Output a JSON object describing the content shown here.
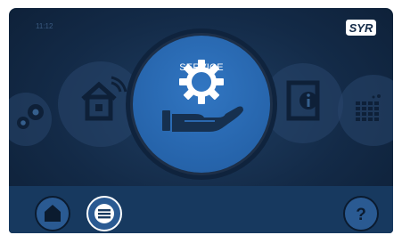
{
  "status_bar": {
    "time": "11:12"
  },
  "brand": {
    "logo_text": "SYR"
  },
  "carousel": {
    "selected": {
      "label": "SERVICE",
      "icon": "service-hand-gear-icon"
    },
    "items": [
      {
        "icon": "settings-gears-icon"
      },
      {
        "icon": "smart-home-wifi-icon"
      },
      {
        "icon": "info-book-icon"
      },
      {
        "icon": "water-calendar-icon"
      }
    ]
  },
  "bottom_bar": {
    "home": {
      "icon": "home-icon"
    },
    "menu": {
      "icon": "menu-icon"
    },
    "help": {
      "icon": "help-icon",
      "label": "?"
    }
  },
  "colors": {
    "background": "#132a47",
    "accent": "#2664ab",
    "bottom_bar": "#17395f",
    "button_fill": "#2a5a92"
  }
}
